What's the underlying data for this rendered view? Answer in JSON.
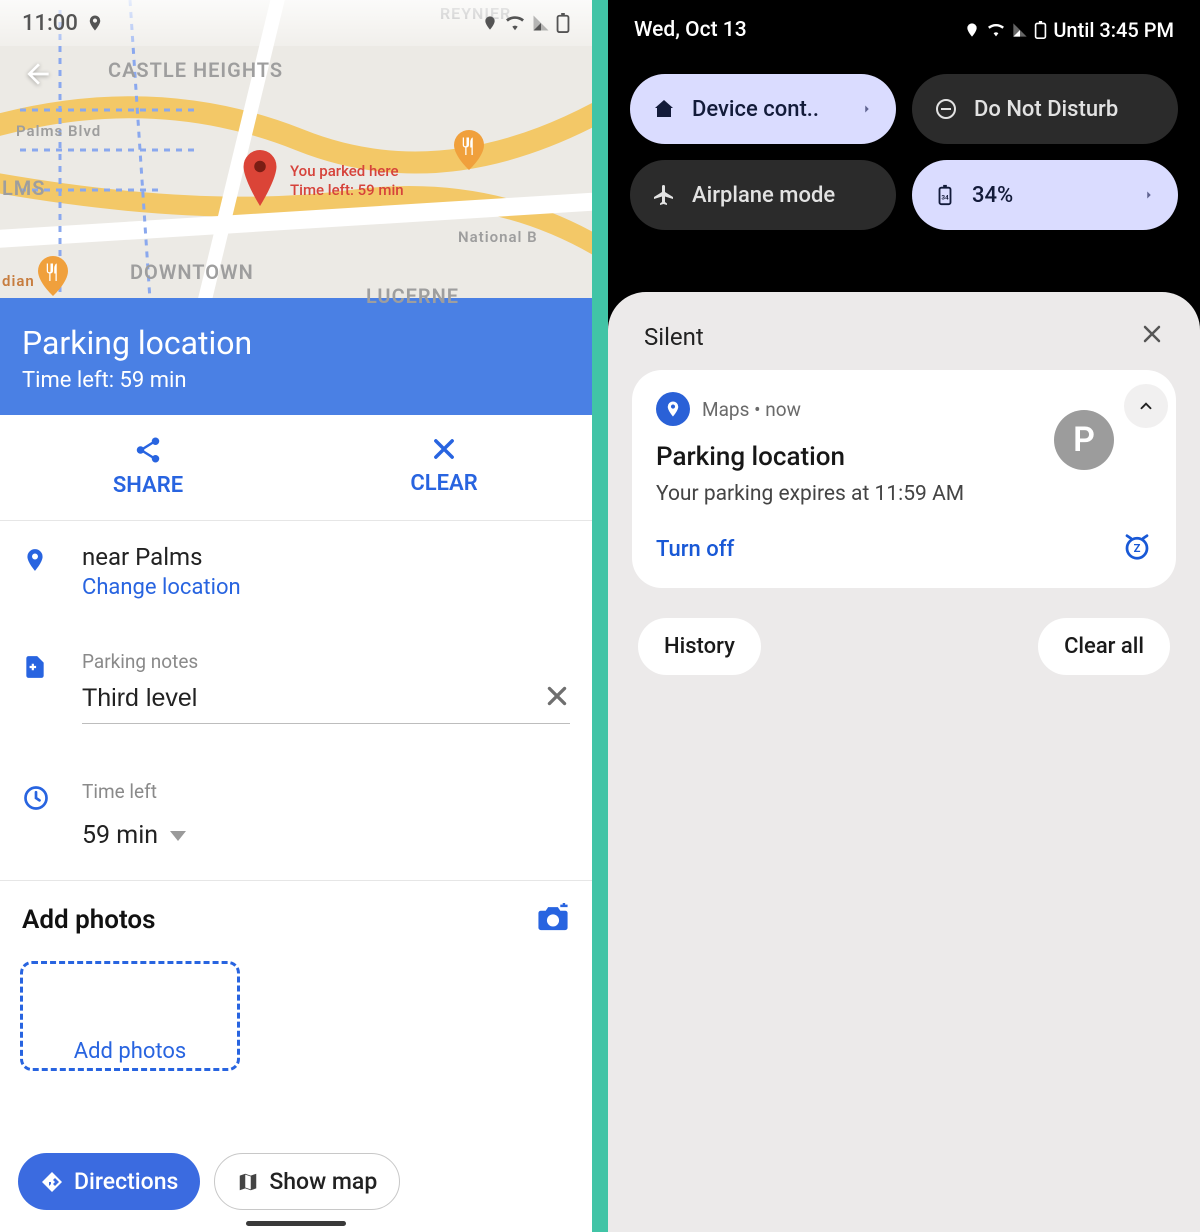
{
  "left": {
    "status": {
      "time": "11:00"
    },
    "map": {
      "labels": [
        "CASTLE HEIGHTS",
        "Palms Blvd",
        "LMS",
        "DOWNTOWN",
        "National B",
        "LUCERNE",
        "REYNIER",
        "dian"
      ],
      "callout_line1": "You parked here",
      "callout_line2": "Time left: 59 min"
    },
    "header": {
      "title": "Parking location",
      "subtitle": "Time left: 59 min"
    },
    "actions": {
      "share": "SHARE",
      "clear": "CLEAR"
    },
    "location": {
      "name": "near Palms",
      "change": "Change location"
    },
    "notes": {
      "label": "Parking notes",
      "value": "Third level"
    },
    "time": {
      "label": "Time left",
      "value": "59 min"
    },
    "photos": {
      "heading": "Add photos",
      "placeholder": "Add photos"
    },
    "bottom": {
      "directions": "Directions",
      "showmap": "Show map"
    }
  },
  "right": {
    "status": {
      "date": "Wed, Oct 13",
      "until": "Until 3:45 PM"
    },
    "qs": {
      "device": "Device cont..",
      "dnd": "Do Not Disturb",
      "airplane": "Airplane mode",
      "battery": "34%"
    },
    "sheet": {
      "silent": "Silent",
      "notif": {
        "app": "Maps",
        "when": "now",
        "avatar_letter": "P",
        "title": "Parking location",
        "body": "Your parking expires at 11:59 AM",
        "turn_off": "Turn off"
      },
      "history": "History",
      "clear_all": "Clear all"
    }
  }
}
